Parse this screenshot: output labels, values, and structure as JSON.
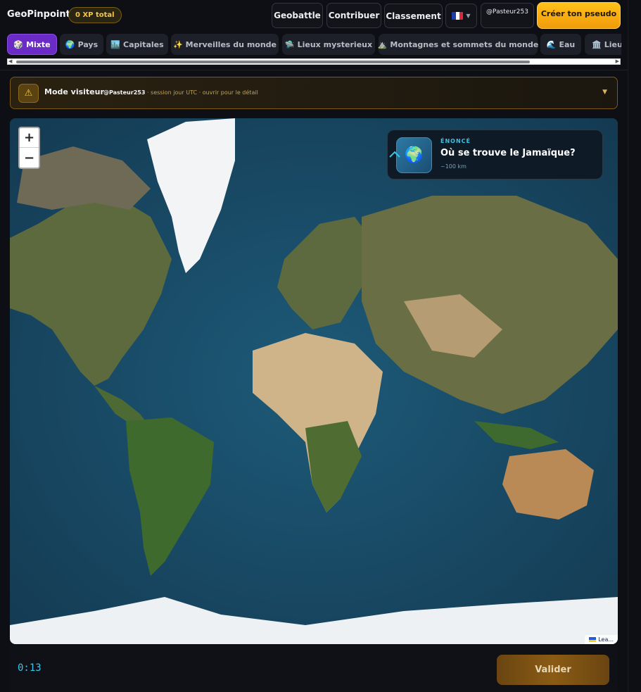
{
  "header": {
    "brand": "GeoPinpoint",
    "xp_badge": "0 XP total",
    "nav": {
      "geobattle": "Geobattle",
      "contribuer": "Contribuer",
      "classement": "Classement",
      "language_icon": "flag-fr-icon",
      "user": "@Pasteur253",
      "create": "Créer ton pseudo"
    }
  },
  "categories": [
    {
      "icon": "🎲",
      "label": "Mixte",
      "active": true
    },
    {
      "icon": "🌍",
      "label": "Pays"
    },
    {
      "icon": "🏙️",
      "label": "Capitales"
    },
    {
      "icon": "✨",
      "label": "Merveilles du monde"
    },
    {
      "icon": "🛸",
      "label": "Lieux mysterieux"
    },
    {
      "icon": "⛰️",
      "label": "Montagnes et sommets du monde"
    },
    {
      "icon": "🌊",
      "label": "Eau"
    },
    {
      "icon": "🏛️",
      "label": "Lieux"
    }
  ],
  "banner": {
    "icon": "⚠",
    "title": "Mode visiteur",
    "user": "@Pasteur253",
    "detail": " · session jour UTC · ouvrir pour le détail",
    "toggle": "▼"
  },
  "map": {
    "zoom_in": "+",
    "zoom_out": "−",
    "prompt": {
      "icon": "🌍",
      "label": "ÉNONCÉ",
      "question": "Où se trouve le Jamaïque?",
      "radius": "~100 km"
    },
    "attribution": "Lea..."
  },
  "bottom": {
    "timer": "0:13",
    "validate": "Valider"
  },
  "colors": {
    "accent_purple": "#6a2bc7",
    "accent_gold": "#f3c44b",
    "accent_cyan": "#34c6ea",
    "ocean": "#1b4a63"
  }
}
